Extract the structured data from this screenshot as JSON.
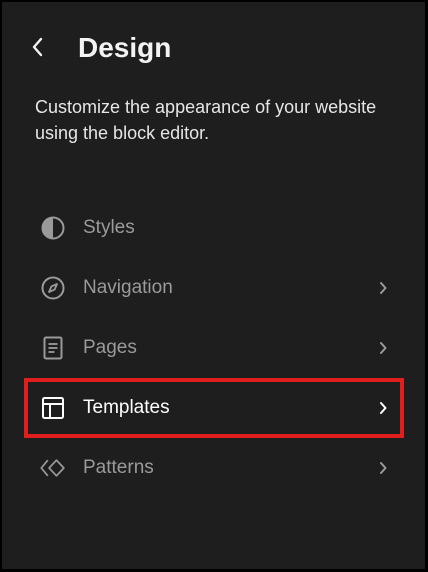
{
  "header": {
    "title": "Design",
    "back_icon": "chevron-left-icon"
  },
  "description": "Customize the appearance of your website using the block editor.",
  "menu": {
    "items": [
      {
        "label": "Styles",
        "icon": "half-circle-contrast-icon",
        "has_chevron": false,
        "active": false
      },
      {
        "label": "Navigation",
        "icon": "compass-icon",
        "has_chevron": true,
        "active": false
      },
      {
        "label": "Pages",
        "icon": "page-icon",
        "has_chevron": true,
        "active": false
      },
      {
        "label": "Templates",
        "icon": "layout-icon",
        "has_chevron": true,
        "active": true
      },
      {
        "label": "Patterns",
        "icon": "symbol-diamond-icon",
        "has_chevron": true,
        "active": false
      }
    ]
  },
  "colors": {
    "panel_bg": "#1e1e1e",
    "outer_border": "#000000",
    "highlight_border": "#e01e1e",
    "text_primary": "#ffffff",
    "text_muted": "#9a9a9a"
  }
}
